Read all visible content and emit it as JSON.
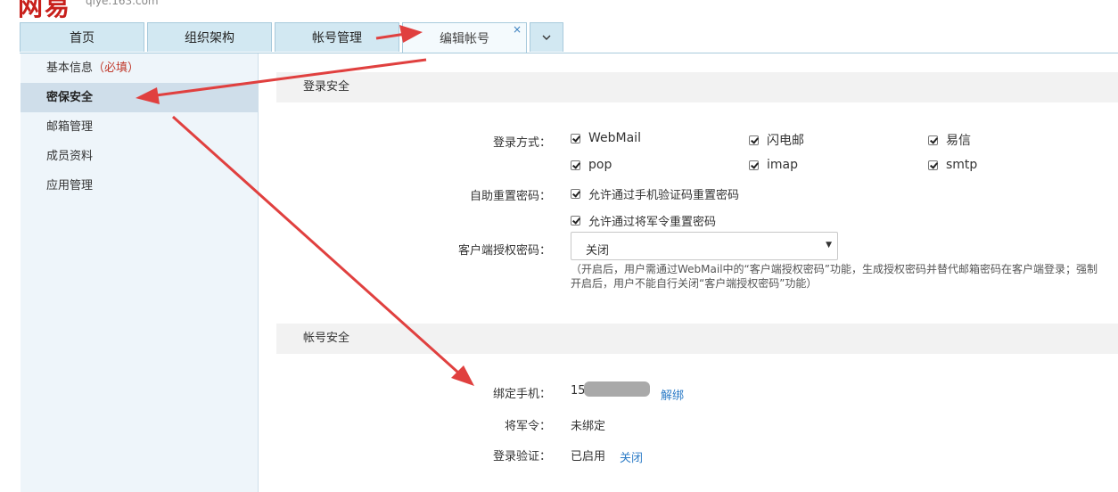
{
  "header": {
    "logo": "网易",
    "domain": "qiye.163.com"
  },
  "tabs": [
    {
      "label": "首页"
    },
    {
      "label": "组织架构"
    },
    {
      "label": "帐号管理"
    },
    {
      "label": "编辑帐号",
      "close": "×"
    }
  ],
  "tab_more_icon": "chevron-down-icon",
  "sidebar": {
    "items": [
      {
        "label": "基本信息",
        "required": "（必填）"
      },
      {
        "label": "密保安全"
      },
      {
        "label": "邮箱管理"
      },
      {
        "label": "成员资料"
      },
      {
        "label": "应用管理"
      }
    ]
  },
  "login_security": {
    "title": "登录安全",
    "login_method_label": "登录方式：",
    "methods": [
      "WebMail",
      "闪电邮",
      "易信",
      "pop",
      "imap",
      "smtp"
    ],
    "reset_label": "自助重置密码：",
    "reset_options": [
      "允许通过手机验证码重置密码",
      "允许通过将军令重置密码"
    ],
    "client_pwd_label": "客户端授权密码：",
    "client_pwd_value": "关闭",
    "note": "（开启后，用户需通过WebMail中的“客户端授权密码”功能，生成授权密码并替代邮箱密码在客户端登录；强制开启后，用户不能自行关闭“客户端授权密码”功能）"
  },
  "account_security": {
    "title": "帐号安全",
    "phone_label": "绑定手机：",
    "phone_value": "15",
    "unbind_link": "解绑",
    "token_label": "将军令：",
    "token_value": "未绑定",
    "verify_label": "登录验证：",
    "verify_value": "已启用",
    "verify_link": "关闭"
  },
  "colors": {
    "tab_bg": "#d2e8f2",
    "sidebar_bg": "#eef5fa",
    "link": "#2d7cc7",
    "arrow": "#e0403f",
    "required": "#c0392b"
  }
}
